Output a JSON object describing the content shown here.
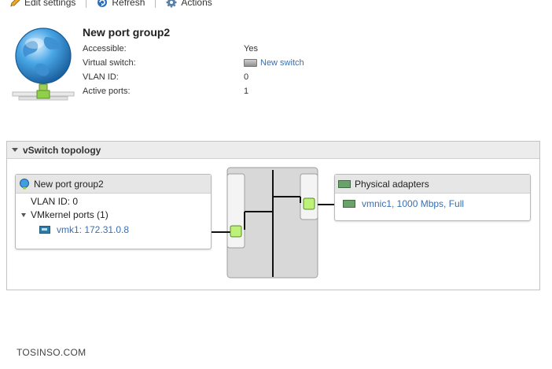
{
  "toolbar": {
    "edit_settings": "Edit settings",
    "refresh": "Refresh",
    "actions": "Actions"
  },
  "portgroup": {
    "name": "New port group2",
    "properties": [
      {
        "key": "Accessible:",
        "value": "Yes"
      },
      {
        "key": "Virtual switch:",
        "value": "New switch",
        "link": true
      },
      {
        "key": "VLAN ID:",
        "value": "0"
      },
      {
        "key": "Active ports:",
        "value": "1"
      }
    ]
  },
  "topology": {
    "header": "vSwitch topology",
    "portgroup_box": {
      "title": "New port group2",
      "vlan": "VLAN ID: 0",
      "vmkernel_label": "VMkernel ports (1)",
      "vmk": "vmk1: 172.31.0.8"
    },
    "physical_box": {
      "title": "Physical adapters",
      "nic": "vmnic1, 1000 Mbps, Full"
    }
  },
  "watermark": "TOSINSO.COM",
  "colors": {
    "link": "#3a6fb0",
    "port_green": "#bff07a",
    "switch_gray": "#d8d8d8",
    "header_bg": "#ececec"
  },
  "icons": [
    "pencil-icon",
    "refresh-icon",
    "gear-icon",
    "globe-network-icon",
    "switch-icon",
    "nic-icon",
    "physical-adapter-icon"
  ]
}
